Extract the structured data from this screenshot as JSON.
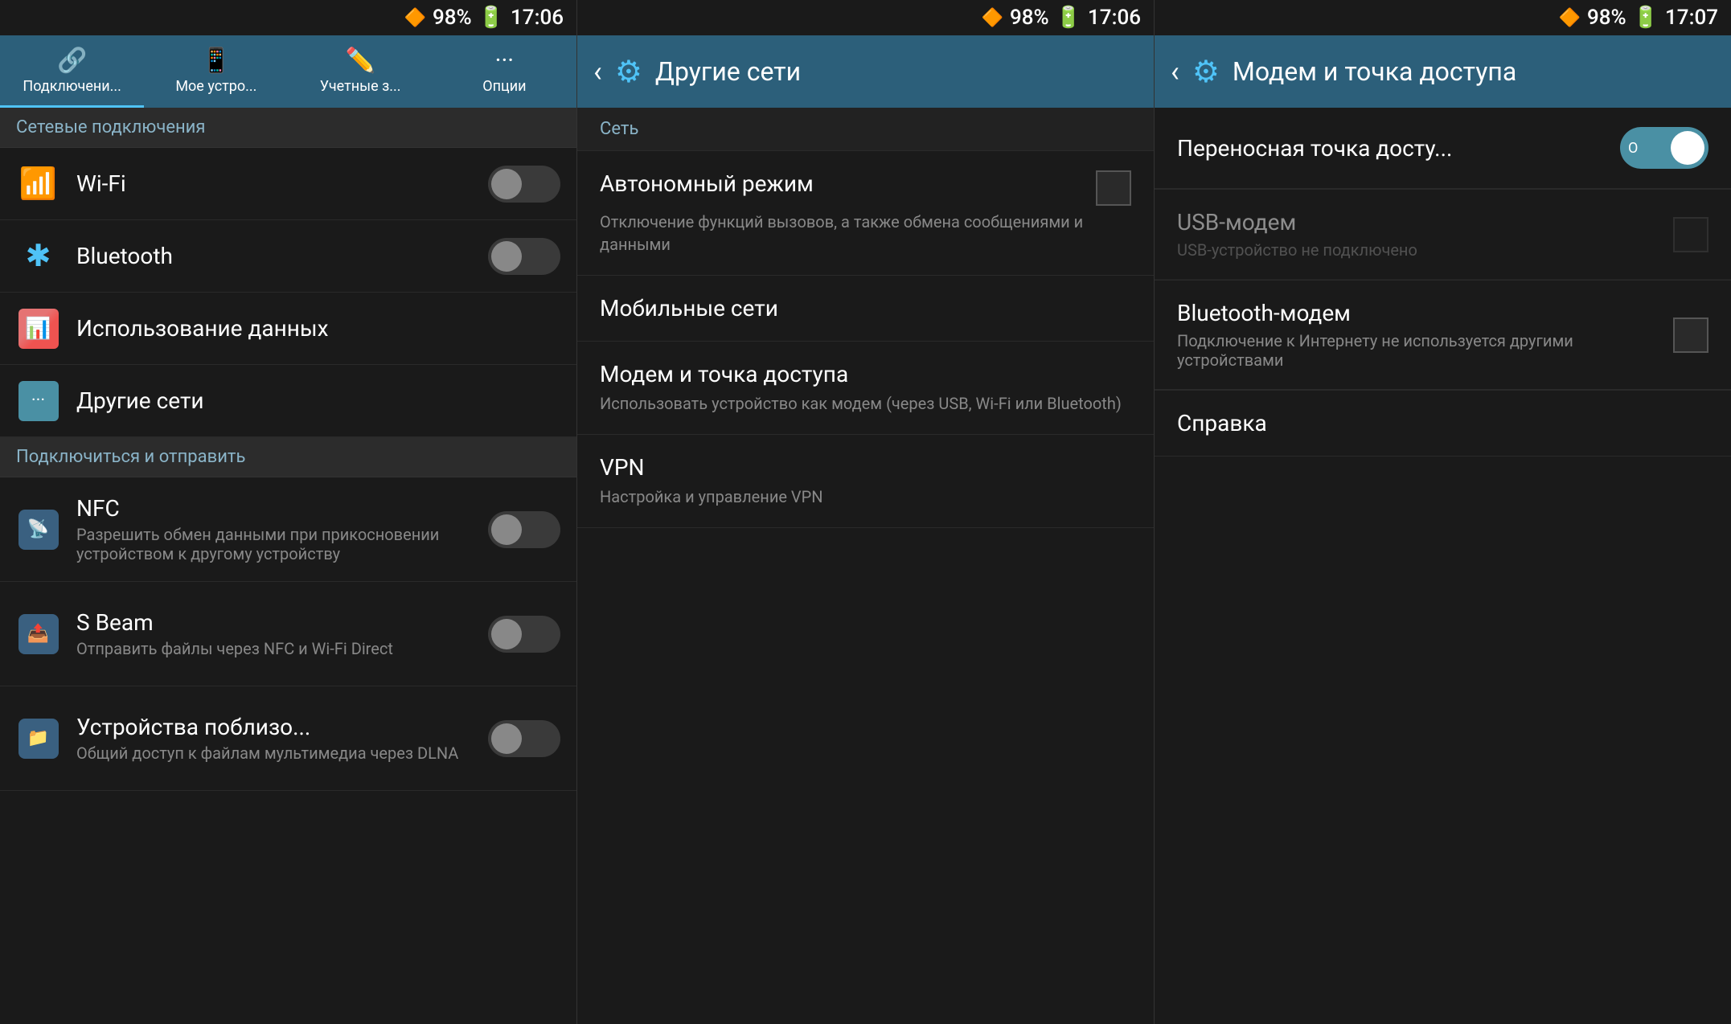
{
  "panel1": {
    "status": {
      "signal": "▲▲▲",
      "battery_percent": "98%",
      "battery_icon": "🔋",
      "time": "17:06"
    },
    "tabs": [
      {
        "id": "connections",
        "icon": "🔗",
        "label": "Подключени...",
        "active": true
      },
      {
        "id": "my-device",
        "icon": "📱",
        "label": "Мое устро..."
      },
      {
        "id": "accounts",
        "icon": "✏️",
        "label": "Учетные з..."
      },
      {
        "id": "options",
        "icon": "···",
        "label": "Опции"
      }
    ],
    "section_network": "Сетевые подключения",
    "items_network": [
      {
        "id": "wifi",
        "icon": "wifi",
        "label": "Wi-Fi",
        "toggle": true,
        "toggle_on": false
      },
      {
        "id": "bluetooth",
        "icon": "bluetooth",
        "label": "Bluetooth",
        "toggle": true,
        "toggle_on": false
      }
    ],
    "item_data": {
      "id": "data-usage",
      "icon": "chart",
      "label": "Использование данных"
    },
    "item_other": {
      "id": "other-networks",
      "icon": "other",
      "label": "Другие сети"
    },
    "section_connect": "Подключиться и отправить",
    "items_connect": [
      {
        "id": "nfc",
        "icon": "nfc",
        "label": "NFC",
        "subtitle": "Разрешить обмен данными при прикосновении устройством к другому устройству",
        "toggle": true,
        "toggle_on": false
      },
      {
        "id": "sbeam",
        "icon": "beam",
        "label": "S Beam",
        "subtitle": "Отправить файлы через NFC и Wi-Fi Direct",
        "toggle": true,
        "toggle_on": false
      },
      {
        "id": "nearby",
        "icon": "devices",
        "label": "Устройства поблизо...",
        "subtitle": "Общий доступ к файлам мультимедиа через DLNA",
        "toggle": true,
        "toggle_on": false
      }
    ]
  },
  "panel2": {
    "status": {
      "signal": "▲▲▲",
      "battery_percent": "98%",
      "time": "17:06"
    },
    "header": {
      "back": "‹",
      "icon": "⚙",
      "title": "Другие сети"
    },
    "section": "Сеть",
    "items": [
      {
        "id": "airplane",
        "label": "Автономный режим",
        "subtitle": "Отключение функций вызовов, а также обмена сообщениями и данными",
        "has_checkbox": true
      },
      {
        "id": "mobile-networks",
        "label": "Мобильные сети",
        "subtitle": "",
        "has_checkbox": false
      },
      {
        "id": "modem",
        "label": "Модем и точка доступа",
        "subtitle": "Использовать устройство как модем (через USB, Wi-Fi или Bluetooth)",
        "has_checkbox": false
      },
      {
        "id": "vpn",
        "label": "VPN",
        "subtitle": "Настройка и управление VPN",
        "has_checkbox": false
      }
    ]
  },
  "panel3": {
    "status": {
      "signal": "▲▲▲",
      "battery_percent": "98%",
      "time": "17:07"
    },
    "header": {
      "back": "‹",
      "icon": "⚙",
      "title": "Модем и точка доступа"
    },
    "items": [
      {
        "id": "portable-hotspot",
        "label": "Переносная точка досту...",
        "subtitle": "",
        "toggle_on": true,
        "disabled": false
      },
      {
        "id": "usb-modem",
        "label": "USB-модем",
        "subtitle": "USB-устройство не подключено",
        "toggle_on": false,
        "disabled": true
      },
      {
        "id": "bluetooth-modem",
        "label": "Bluetooth-модем",
        "subtitle": "Подключение к Интернету не используется другими устройствами",
        "toggle_on": false,
        "disabled": false
      }
    ],
    "help_label": "Справка"
  }
}
